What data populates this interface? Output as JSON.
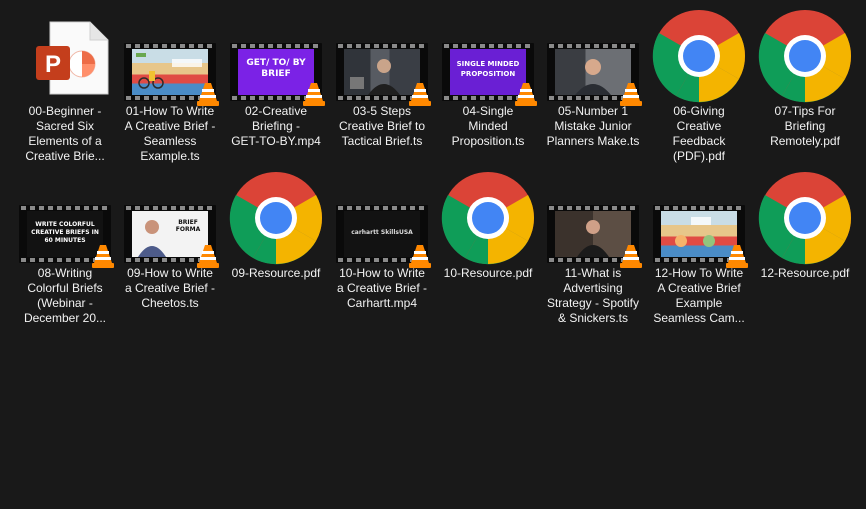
{
  "files": [
    {
      "label": "00-Beginner -\nSacred Six\nElements of a\nCreative Brie...",
      "type": "powerpoint"
    },
    {
      "label": "01-How To Write\nA Creative Brief -\nSeamless\nExample.ts",
      "type": "video",
      "thumb": "cartoon"
    },
    {
      "label": "02-Creative\nBriefing -\nGET-TO-BY.mp4",
      "type": "video",
      "thumb": "purple",
      "thumb_text": "GET/ TO/ BY\nBRIEF"
    },
    {
      "label": "03-5 Steps\nCreative Brief to\nTactical Brief.ts",
      "type": "video",
      "thumb": "office"
    },
    {
      "label": "04-Single\nMinded\nProposition.ts",
      "type": "video",
      "thumb": "purple",
      "thumb_text": "SINGLE MINDED\nPROPOSITION"
    },
    {
      "label": "05-Number 1\nMistake Junior\nPlanners Make.ts",
      "type": "video",
      "thumb": "office"
    },
    {
      "label": "06-Giving\nCreative\nFeedback\n(PDF).pdf",
      "type": "pdf"
    },
    {
      "label": "07-Tips For\nBriefing\nRemotely.pdf",
      "type": "pdf"
    },
    {
      "label": "08-Writing\nColorful Briefs\n(Webinar -\nDecember 20...",
      "type": "video",
      "thumb": "dark",
      "thumb_text": "WRITE COLORFUL\nCREATIVE BRIEFS IN\n60 MINUTES"
    },
    {
      "label": "09-How to Write\na Creative Brief -\nCheetos.ts",
      "type": "video",
      "thumb": "white",
      "thumb_text": "BRIEF FORMA"
    },
    {
      "label": "09-Resource.pdf",
      "type": "pdf"
    },
    {
      "label": "10-How to Write\na Creative Brief -\nCarhartt.mp4",
      "type": "video",
      "thumb": "dark",
      "thumb_text": "carhartt   SkillsUSA"
    },
    {
      "label": "10-Resource.pdf",
      "type": "pdf"
    },
    {
      "label": "11-What is\nAdvertising\nStrategy - Spotify\n& Snickers.ts",
      "type": "video",
      "thumb": "grey"
    },
    {
      "label": "12-How To Write\nA Creative Brief\nExample\nSeamless Cam...",
      "type": "video",
      "thumb": "cartoon"
    },
    {
      "label": "12-Resource.pdf",
      "type": "pdf"
    }
  ],
  "colors": {
    "background": "#191919",
    "text": "#f2f2f2",
    "powerpoint": "#c43e1c",
    "chrome_red": "#db4437",
    "chrome_yellow": "#f4b400",
    "chrome_green": "#0f9d58",
    "chrome_blue": "#4285f4",
    "vlc_orange": "#ff8800"
  }
}
